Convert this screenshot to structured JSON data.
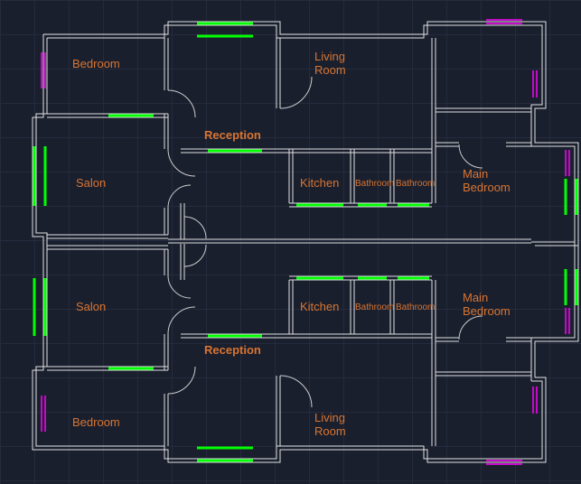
{
  "rooms": {
    "bedroom1": "Bedroom",
    "bedroom2": "Bedroom",
    "salon1": "Salon",
    "salon2": "Salon",
    "reception1": "Reception",
    "reception2": "Reception",
    "living1": "Living\nRoom",
    "living2": "Living\nRoom",
    "kitchen1": "Kitchen",
    "kitchen2": "Kitchen",
    "bathroom1a": "Bathroom",
    "bathroom1b": "Bathroom",
    "bathroom2a": "Bathroom",
    "bathroom2b": "Bathroom",
    "mainbed1": "Main\nBedroom",
    "mainbed2": "Main\nBedroom"
  }
}
